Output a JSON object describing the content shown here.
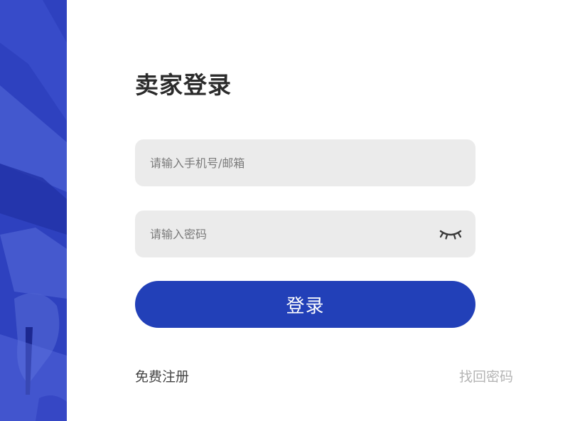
{
  "login": {
    "title": "卖家登录",
    "account_placeholder": "请输入手机号/邮箱",
    "password_placeholder": "请输入密码",
    "submit_label": "登录",
    "register_label": "免费注册",
    "forgot_label": "找回密码"
  },
  "icons": {
    "password_toggle": "eye-closed-icon"
  },
  "colors": {
    "primary": "#2240b8",
    "side_image": "#2d3fbd",
    "input_bg": "#ebebeb",
    "title": "#2b2b2b",
    "register_link": "#444444",
    "forgot_link": "#b4b4b4"
  }
}
